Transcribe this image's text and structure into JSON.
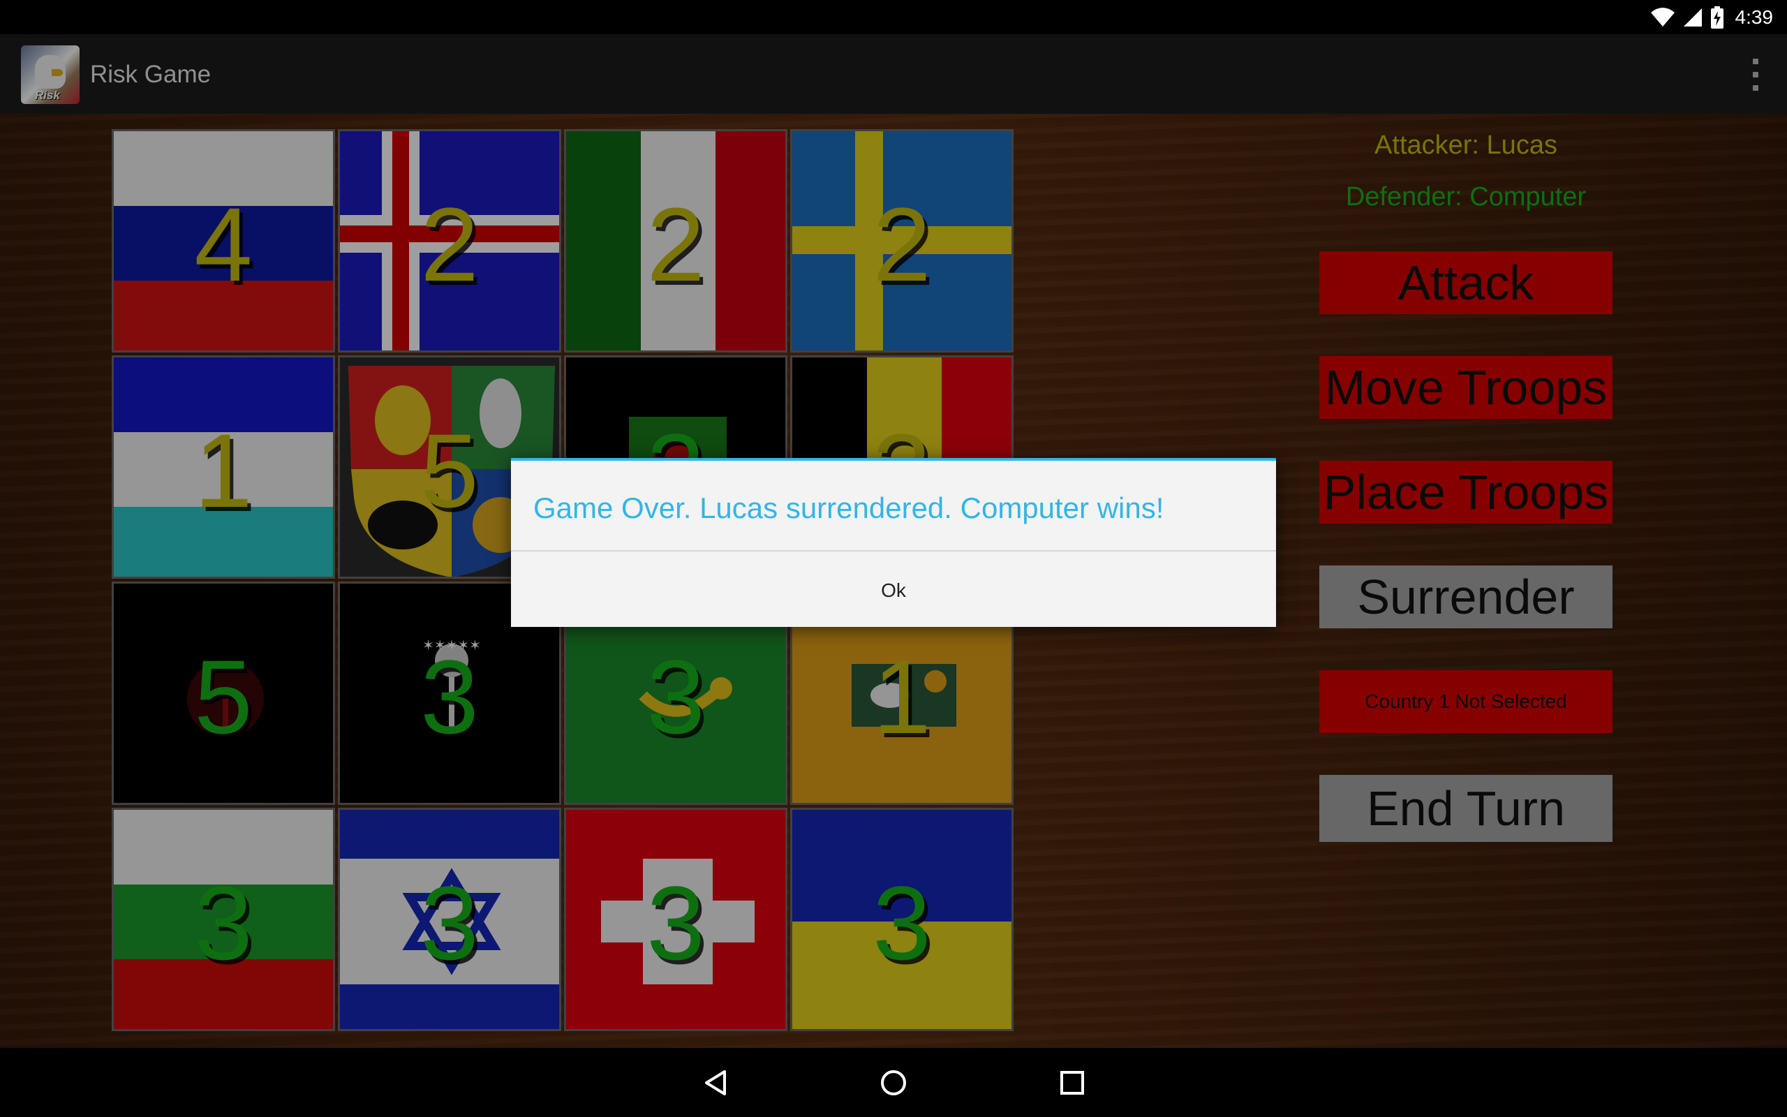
{
  "status_bar": {
    "time": "4:39"
  },
  "action_bar": {
    "app_title": "Risk Game",
    "app_icon_text": "Risk"
  },
  "board": {
    "tiles": [
      {
        "country": "Russia",
        "troops": "4",
        "owner": "attacker"
      },
      {
        "country": "Iceland",
        "troops": "2",
        "owner": "attacker"
      },
      {
        "country": "Italy",
        "troops": "2",
        "owner": "attacker"
      },
      {
        "country": "Sweden",
        "troops": "2",
        "owner": "attacker"
      },
      {
        "country": "Sierra Leone",
        "troops": "1",
        "owner": "attacker"
      },
      {
        "country": "Coat of Arms",
        "troops": "5",
        "owner": "attacker"
      },
      {
        "country": "Green Emblem",
        "troops": "3",
        "owner": "attacker"
      },
      {
        "country": "Belgium",
        "troops": "3",
        "owner": "attacker"
      },
      {
        "country": "Red Tree",
        "troops": "5",
        "owner": "defender"
      },
      {
        "country": "White Tree",
        "troops": "3",
        "owner": "defender"
      },
      {
        "country": "Horn",
        "troops": "3",
        "owner": "defender"
      },
      {
        "country": "Horse",
        "troops": "1",
        "owner": "attacker"
      },
      {
        "country": "Bulgaria",
        "troops": "3",
        "owner": "defender"
      },
      {
        "country": "Israel",
        "troops": "3",
        "owner": "defender"
      },
      {
        "country": "Switzerland",
        "troops": "3",
        "owner": "defender"
      },
      {
        "country": "Ukraine",
        "troops": "3",
        "owner": "defender"
      }
    ]
  },
  "panel": {
    "attacker": "Attacker: Lucas",
    "defender": "Defender: Computer",
    "attack": "Attack",
    "move_troops": "Move Troops",
    "place_troops": "Place Troops",
    "surrender": "Surrender",
    "country_status": "Country 1 Not Selected",
    "end_turn": "End Turn"
  },
  "dialog": {
    "message": "Game Over. Lucas surrendered. Computer wins!",
    "ok": "Ok"
  },
  "colors": {
    "attacker_text": "#c6bc12",
    "defender_text": "#17b31b",
    "action_red": "#d80000",
    "action_gray": "#a6a6a6",
    "dialog_accent": "#33b5e5"
  }
}
